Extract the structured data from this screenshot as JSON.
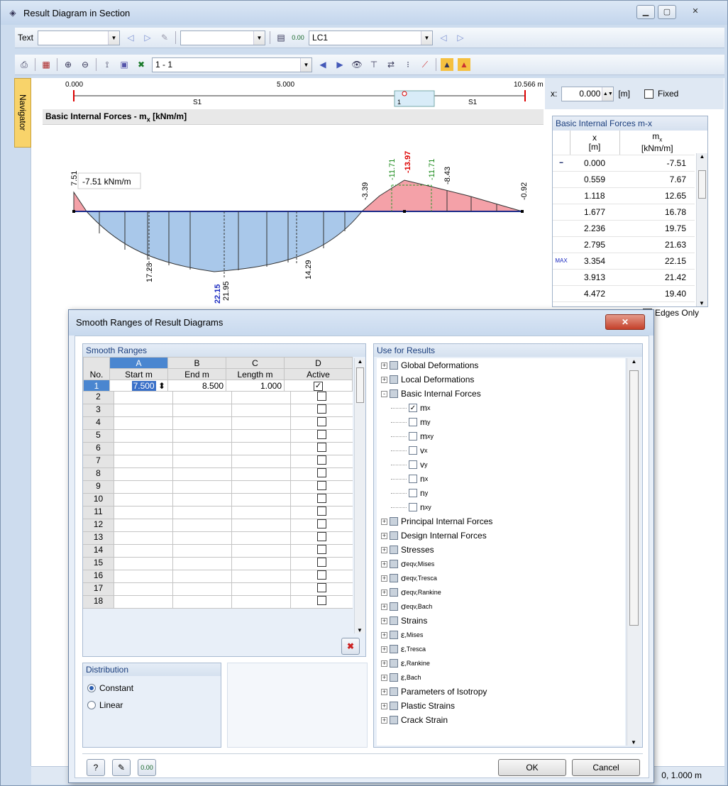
{
  "window": {
    "title": "Result Diagram in Section"
  },
  "toolbar1": {
    "text_label": "Text",
    "loadcase": "LC1"
  },
  "toolbar2": {
    "section_combo": "1 - 1"
  },
  "navigator": {
    "label": "Navigator"
  },
  "ruler": {
    "start": "0.000",
    "mid": "5.000",
    "end": "10.566 m",
    "seg1": "S1",
    "seg2": "S1",
    "marker": "1"
  },
  "xfield": {
    "label": "x:",
    "value": "0.000",
    "unit": "[m]",
    "fixed_label": "Fixed"
  },
  "diagram": {
    "header": "Basic Internal Forces - m",
    "header_sub": "x",
    "header_unit": " [kNm/m]",
    "callout": "-7.51 kNm/m",
    "labels": {
      "left": "7.51",
      "a": "17.23",
      "b": "22.15",
      "b2": "21.95",
      "c": "14.29",
      "d": "-3.39",
      "e": "-11.71",
      "f": "-13.97",
      "g": "-11.71",
      "h": "-8.43",
      "i": "-0.92"
    }
  },
  "result_table": {
    "title": "Basic Internal Forces m-x",
    "col_x": "x",
    "col_x_unit": "[m]",
    "col_m": "m",
    "col_m_sub": "x",
    "col_m_unit": "[kNm/m]",
    "max_tag": "MAX",
    "rows": [
      {
        "x": "0.000",
        "m": "-7.51"
      },
      {
        "x": "0.559",
        "m": "7.67"
      },
      {
        "x": "1.118",
        "m": "12.65"
      },
      {
        "x": "1.677",
        "m": "16.78"
      },
      {
        "x": "2.236",
        "m": "19.75"
      },
      {
        "x": "2.795",
        "m": "21.63"
      },
      {
        "x": "3.354",
        "m": "22.15"
      },
      {
        "x": "3.913",
        "m": "21.42"
      },
      {
        "x": "4.472",
        "m": "19.40"
      }
    ],
    "edges_only": "Edges Only"
  },
  "status": {
    "right": "0, 1.000 m"
  },
  "dialog": {
    "title": "Smooth Ranges of Result Diagrams",
    "smooth_ranges": {
      "header": "Smooth Ranges",
      "col_letters": [
        "A",
        "B",
        "C",
        "D"
      ],
      "col_no": "No.",
      "col_names": [
        "Start m",
        "End m",
        "Length m",
        "Active"
      ],
      "row1": {
        "no": "1",
        "start": "7.500",
        "end": "8.500",
        "length": "1.000"
      },
      "rows": [
        "2",
        "3",
        "4",
        "5",
        "6",
        "7",
        "8",
        "9",
        "10",
        "11",
        "12",
        "13",
        "14",
        "15",
        "16",
        "17",
        "18"
      ]
    },
    "distribution": {
      "header": "Distribution",
      "constant": "Constant",
      "linear": "Linear"
    },
    "use_for_results": {
      "header": "Use for Results",
      "items_top": [
        "Global Deformations",
        "Local Deformations",
        "Basic Internal Forces"
      ],
      "children": [
        {
          "b": "m",
          "s": "x",
          "checked": true
        },
        {
          "b": "m",
          "s": "y"
        },
        {
          "b": "m",
          "s": "xy"
        },
        {
          "b": "v",
          "s": "x"
        },
        {
          "b": "v",
          "s": "y"
        },
        {
          "b": "n",
          "s": "x"
        },
        {
          "b": "n",
          "s": "y"
        },
        {
          "b": "n",
          "s": "xy"
        }
      ],
      "items_bottom": [
        "Principal Internal Forces",
        "Design Internal Forces",
        "Stresses"
      ],
      "sigma": [
        {
          "b": "σ",
          "s": "eqv,Mises"
        },
        {
          "b": "σ",
          "s": "eqv,Tresca"
        },
        {
          "b": "σ",
          "s": "eqv,Rankine"
        },
        {
          "b": "σ",
          "s": "eqv,Bach"
        }
      ],
      "strains": "Strains",
      "eps": [
        {
          "b": "ε",
          "s": ",Mises"
        },
        {
          "b": "ε",
          "s": ",Tresca"
        },
        {
          "b": "ε",
          "s": ",Rankine"
        },
        {
          "b": "ε",
          "s": ",Bach"
        }
      ],
      "items_end": [
        "Parameters of Isotropy",
        "Plastic Strains",
        "Crack Strain"
      ]
    },
    "ok": "OK",
    "cancel": "Cancel"
  }
}
